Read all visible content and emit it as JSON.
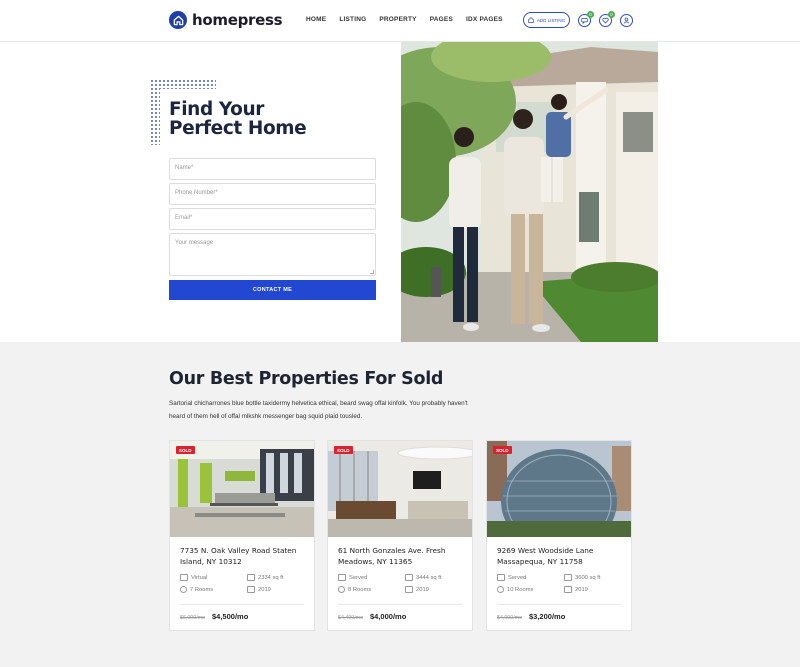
{
  "brand": {
    "name": "homepress",
    "accent": "#2247d1"
  },
  "nav": [
    "HOME",
    "LISTING",
    "PROPERTY",
    "PAGES",
    "IDX PAGES"
  ],
  "header": {
    "add_listing": "ADD LISTING",
    "chat_count": "0",
    "fav_count": "0"
  },
  "hero": {
    "title_line1": "Find Your",
    "title_line2": "Perfect Home",
    "name_placeholder": "Name*",
    "phone_placeholder": "Phone Number*",
    "email_placeholder": "Email*",
    "message_placeholder": "Your message",
    "submit": "CONTACT ME"
  },
  "properties": {
    "title": "Our Best Properties For Sold",
    "desc_line1": "Sartorial chicharrones blue bottle taxidermy helvetica ethical, beard swag offal kinfolk. You probably haven't",
    "desc_line2": "heard of them hell of offal mlkshk messenger bag squid plaid tousled.",
    "cards": [
      {
        "badge": "SOLD",
        "title": "7735 N. Oak Valley Road Staten Island, NY 10312",
        "type": "Virtual",
        "area": "2334 sq ft",
        "rooms": "7 Rooms",
        "year": "2019",
        "old_price": "$6,000/mo",
        "price": "$4,500/mo"
      },
      {
        "badge": "SOLD",
        "title": "61 North Gonzales Ave. Fresh Meadows, NY 11365",
        "type": "Served",
        "area": "3444 sq ft",
        "rooms": "8 Rooms",
        "year": "2019",
        "old_price": "$4,400/mo",
        "price": "$4,000/mo"
      },
      {
        "badge": "SOLD",
        "title": "9269 West Woodside Lane Massapequa, NY 11758",
        "type": "Served",
        "area": "3600 sq ft",
        "rooms": "10 Rooms",
        "year": "2019",
        "old_price": "$4,000/mo",
        "price": "$3,200/mo"
      }
    ]
  }
}
